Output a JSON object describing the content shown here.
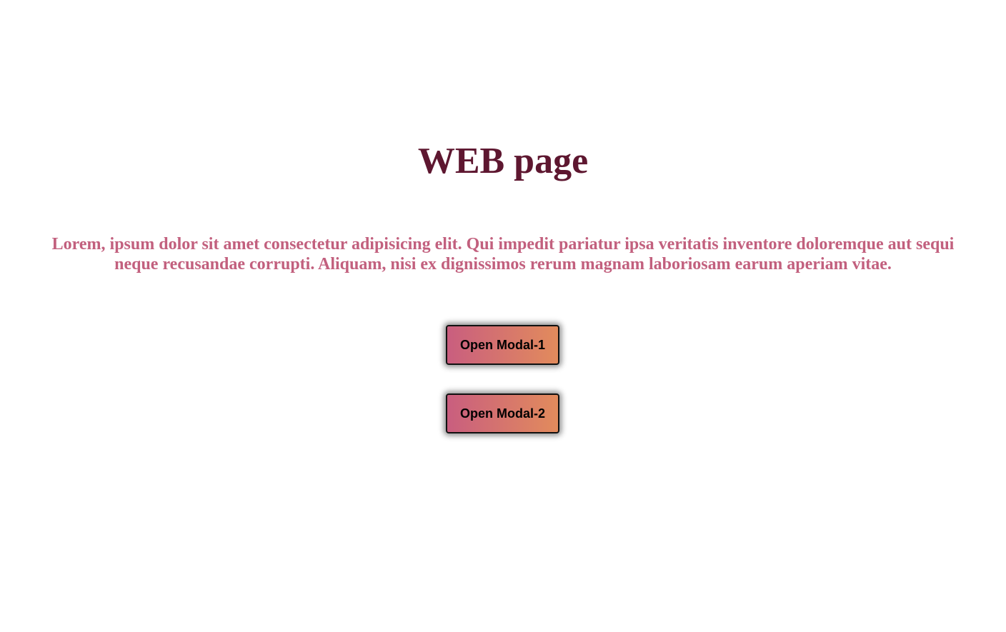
{
  "page": {
    "title": "WEB page",
    "lead": "Lorem, ipsum dolor sit amet consectetur adipisicing elit. Qui impedit pariatur ipsa veritatis inventore doloremque aut sequi neque recusandae corrupti. Aliquam, nisi ex dignissimos rerum magnam laboriosam earum aperiam vitae."
  },
  "buttons": [
    {
      "label": "Open Modal-1"
    },
    {
      "label": "Open Modal-2"
    }
  ],
  "colors": {
    "background": "#ffffff",
    "title": "#5e1730",
    "lead": "#c2607e",
    "button_gradient_start": "#c95e7f",
    "button_gradient_end": "#e28b5c",
    "button_border": "#111111"
  }
}
